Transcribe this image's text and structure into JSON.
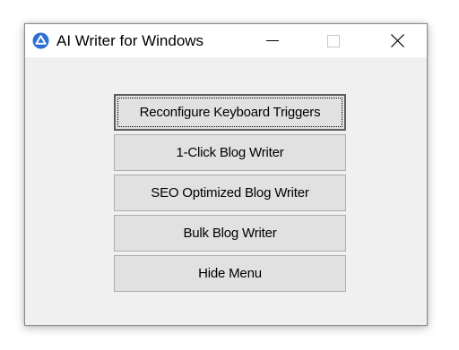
{
  "window": {
    "title": "AI Writer for Windows",
    "icon": "ai-writer-logo-icon",
    "controls": {
      "minimize": "minimize-icon",
      "maximize": "maximize-icon",
      "close": "close-icon"
    }
  },
  "menu": {
    "buttons": [
      {
        "label": "Reconfigure Keyboard Triggers"
      },
      {
        "label": "1-Click Blog Writer"
      },
      {
        "label": "SEO Optimized Blog Writer"
      },
      {
        "label": "Bulk Blog Writer"
      },
      {
        "label": "Hide Menu"
      }
    ]
  },
  "colors": {
    "accent": "#2c6ed5",
    "client_background": "#f0f0f0",
    "button_face": "#e1e1e1"
  }
}
